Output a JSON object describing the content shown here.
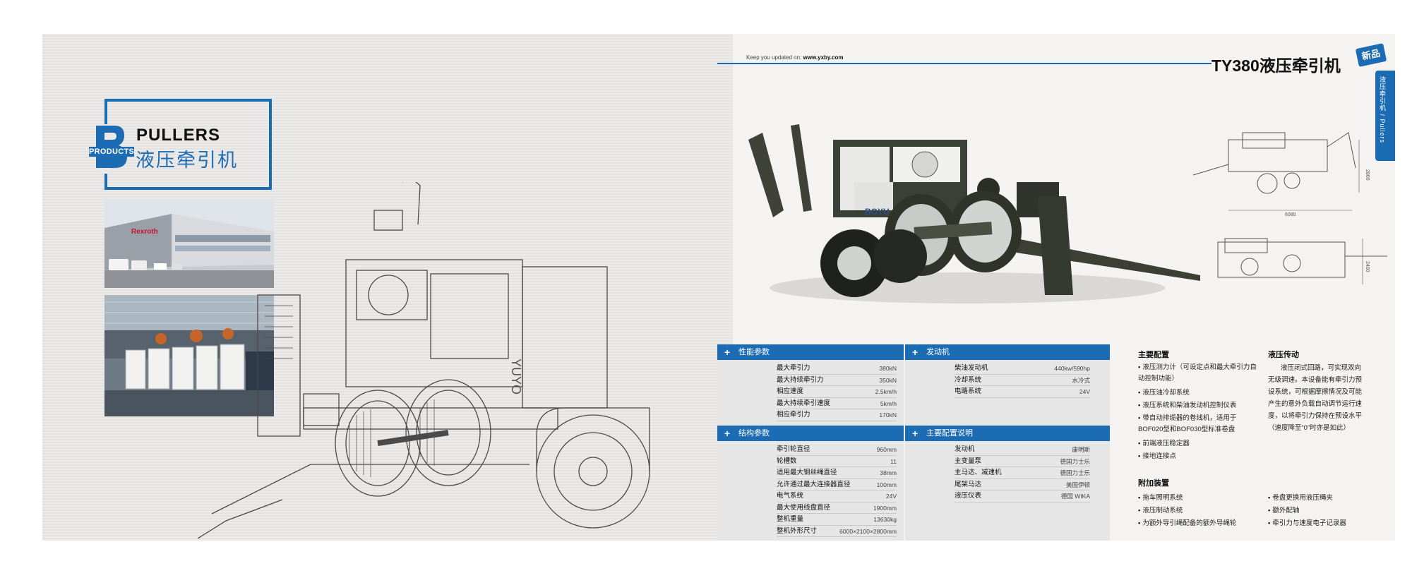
{
  "brand": {
    "logo_letter": "B",
    "products_label": "PRODUCTS",
    "title_en": "PULLERS",
    "title_cn": "液压牵引机"
  },
  "photos": {
    "building_sign": "Rexroth"
  },
  "header": {
    "tagline_prefix": "Keep you updated on:",
    "tagline_url": "www.yxby.com",
    "product_title": "TY380液压牵引机",
    "new_badge": "新品",
    "side_tab": "液压牵引机 / Pullers"
  },
  "machine": {
    "brand_text": "BOYU",
    "sketch_brand": "YUYO"
  },
  "dimensions": {
    "length": "6080",
    "height": "2800",
    "height_top": "2400"
  },
  "performance": {
    "title": "性能参数",
    "rows": [
      {
        "k": "最大牵引力",
        "v": "380kN"
      },
      {
        "k": "最大持续牵引力",
        "v": "350kN"
      },
      {
        "k": "相应速度",
        "v": "2.5km/h"
      },
      {
        "k": "最大持续牵引速度",
        "v": "5km/h"
      },
      {
        "k": "相应牵引力",
        "v": "170kN"
      }
    ]
  },
  "engine": {
    "title": "发动机",
    "rows": [
      {
        "k": "柴油发动机",
        "v": "440kw/590hp"
      },
      {
        "k": "冷却系统",
        "v": "水冷式"
      },
      {
        "k": "电路系统",
        "v": "24V"
      }
    ]
  },
  "structure": {
    "title": "结构参数",
    "rows": [
      {
        "k": "牵引轮直径",
        "v": "960mm"
      },
      {
        "k": "轮槽数",
        "v": "11"
      },
      {
        "k": "适用最大钢丝绳直径",
        "v": "38mm"
      },
      {
        "k": "允许通过最大连接器直径",
        "v": "100mm"
      },
      {
        "k": "电气系统",
        "v": "24V"
      },
      {
        "k": "最大使用线盘直径",
        "v": "1900mm"
      },
      {
        "k": "整机重量",
        "v": "13630kg"
      },
      {
        "k": "整机外形尺寸",
        "v": "6000×2100×2800mm"
      }
    ]
  },
  "main_config": {
    "title": "主要配置说明",
    "rows": [
      {
        "k": "发动机",
        "v": "康明斯"
      },
      {
        "k": "主变量泵",
        "v": "德国力士乐"
      },
      {
        "k": "主马达、减速机",
        "v": "德国力士乐"
      },
      {
        "k": "尾架马达",
        "v": "美国伊顿"
      },
      {
        "k": "液压仪表",
        "v": "德国 WIKA"
      }
    ]
  },
  "key_features": {
    "title": "主要配置",
    "items": [
      "液压测力计（可设定点和最大牵引力自动控制功能）",
      "液压油冷却系统",
      "液压系统和柴油发动机控制仪表",
      "带自动排缆器的卷线机，适用于BOF020型和BOF030型标准卷盘",
      "前端液压稳定器",
      "接地连接点"
    ]
  },
  "hydraulic": {
    "title": "液压传动",
    "text": "液压闭式回路，可实现双向无级调速。本设备能有牵引力预设系统，可根据摩擦情况及可能产生的意外负载自动调节运行速度，以将牵引力保持在预设水平（速度降至“0”时亦是如此）"
  },
  "accessories": {
    "title": "附加装置",
    "col1": [
      "拖车照明系统",
      "液压制动系统",
      "为额外导引绳配备的额外导绳轮"
    ],
    "col2": [
      "卷盘更换用液压绳夹",
      "额外配轴",
      "牵引力与速度电子记录器"
    ]
  },
  "colors": {
    "accent": "#1c6cb4",
    "machine_body": "#3d4236",
    "panel": "#e6e6e6"
  }
}
